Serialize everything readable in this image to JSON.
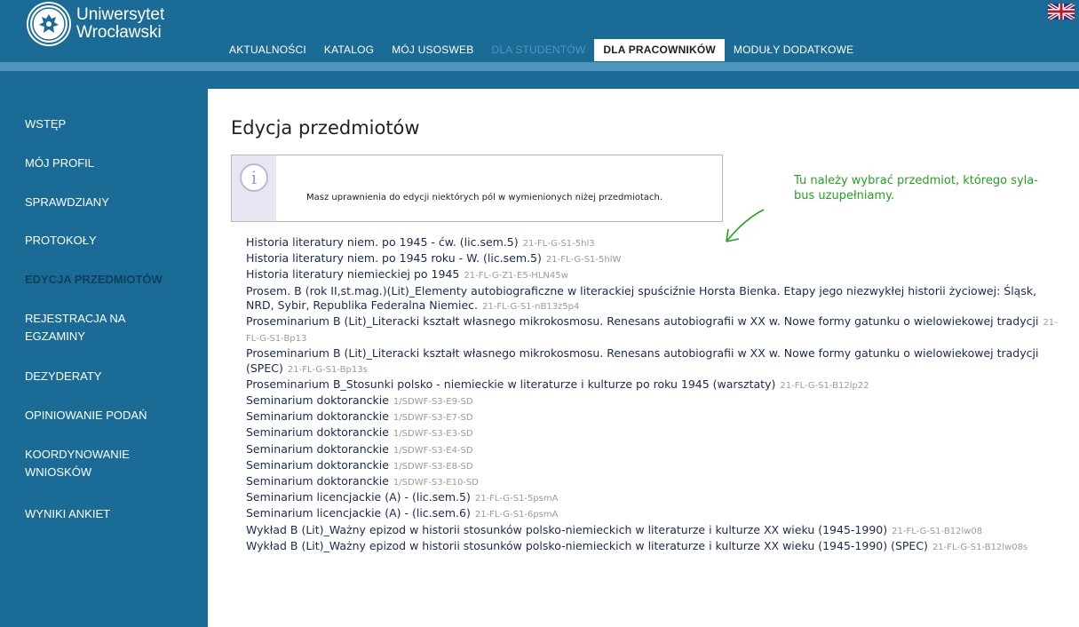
{
  "header": {
    "logo_line1": "Uniwersytet",
    "logo_line2": "Wrocławski",
    "nav": [
      {
        "label": "AKTUALNOŚCI"
      },
      {
        "label": "KATALOG"
      },
      {
        "label": "MÓJ USOSWEB"
      },
      {
        "label": "DLA STUDENTÓW"
      },
      {
        "label": "DLA PRACOWNIKÓW"
      },
      {
        "label": "MODUŁY DODATKOWE"
      }
    ]
  },
  "sidebar": {
    "items": [
      {
        "label": "WSTĘP"
      },
      {
        "label": "MÓJ PROFIL"
      },
      {
        "label": "SPRAWDZIANY"
      },
      {
        "label": "PROTOKOŁY"
      },
      {
        "label": "EDYCJA PRZEDMIOTÓW"
      },
      {
        "label": "REJESTRACJA NA",
        "label2": "EGZAMINY"
      },
      {
        "label": "DEZYDERATY"
      },
      {
        "label": "OPINIOWANIE PODAŃ"
      },
      {
        "label": "KOORDYNOWANIE",
        "label2": "WNIOSKÓW"
      },
      {
        "label": "WYNIKI ANKIET"
      }
    ]
  },
  "main": {
    "title": "Edycja przedmiotów",
    "info_text": "Masz uprawnienia do edycji niektórych pól w wymienionych niżej przedmiotach.",
    "annotation_line1": "Tu należy wybrać przedmiot, którego syla-",
    "annotation_line2": "bus uzupełniamy.",
    "courses": [
      {
        "name": "Historia literatury niem. po 1945 - ćw. (lic.sem.5)",
        "code": "21-FL-G-S1-5hl3"
      },
      {
        "name": "Historia literatury niem. po 1945 roku - W. (lic.sem.5)",
        "code": "21-FL-G-S1-5hlW"
      },
      {
        "name": "Historia literatury niemieckiej po 1945",
        "code": "21-FL-G-Z1-E5-HLN45w"
      },
      {
        "name": "Prosem. B (rok II,st.mag.)(Lit)_Elementy autobiograficzne w literackiej spuściźnie Horsta Bienka. Etapy jego niezwykłej historii życiowej: Śląsk, NRD, Sybir, Republika Federalna Niemiec.",
        "code": "21-FL-G-S1-nB13z5p4"
      },
      {
        "name": "Proseminarium B (Lit)_Literacki kształt własnego mikrokosmosu. Renesans autobiografii w XX w. Nowe formy gatunku o wielowiekowej tradycji",
        "code": "21-FL-G-S1-Bp13"
      },
      {
        "name": "Proseminarium B (Lit)_Literacki kształt własnego mikrokosmosu. Renesans autobiografii w XX w. Nowe formy gatunku o wielowiekowej tradycji (SPEC)",
        "code": "21-FL-G-S1-Bp13s"
      },
      {
        "name": "Proseminarium B_Stosunki polsko - niemieckie w literaturze i kulturze po roku 1945 (warsztaty)",
        "code": "21-FL-G-S1-B12lp22"
      },
      {
        "name": "Seminarium doktoranckie",
        "code": "1/SDWF-S3-E9-SD"
      },
      {
        "name": "Seminarium doktoranckie",
        "code": "1/SDWF-S3-E7-SD"
      },
      {
        "name": "Seminarium doktoranckie",
        "code": "1/SDWF-S3-E3-SD"
      },
      {
        "name": "Seminarium doktoranckie",
        "code": "1/SDWF-S3-E4-SD"
      },
      {
        "name": "Seminarium doktoranckie",
        "code": "1/SDWF-S3-E8-SD"
      },
      {
        "name": "Seminarium doktoranckie",
        "code": "1/SDWF-S3-E10-SD"
      },
      {
        "name": "Seminarium licencjackie (A) - (lic.sem.5)",
        "code": "21-FL-G-S1-5psmA"
      },
      {
        "name": "Seminarium licencjackie (A) - (lic.sem.6)",
        "code": "21-FL-G-S1-6psmA"
      },
      {
        "name": "Wykład B (Lit)_Ważny epizod w historii stosunków polsko-niemieckich w literaturze i kulturze XX wieku (1945-1990)",
        "code": "21-FL-G-S1-B12lw08"
      },
      {
        "name": "Wykład B (Lit)_Ważny epizod w historii stosunków polsko-niemieckich w literaturze i kulturze XX wieku (1945-1990) (SPEC)",
        "code": "21-FL-G-S1-B12lw08s"
      }
    ]
  },
  "colors": {
    "brand_blue": "#1a6b96",
    "stripe_blue": "#4e95be",
    "annotation_green": "#23a11f",
    "link_dark": "#1a2a52"
  },
  "icons": [
    "crest-icon",
    "uk-flag-icon",
    "info-icon",
    "arrow-icon"
  ]
}
